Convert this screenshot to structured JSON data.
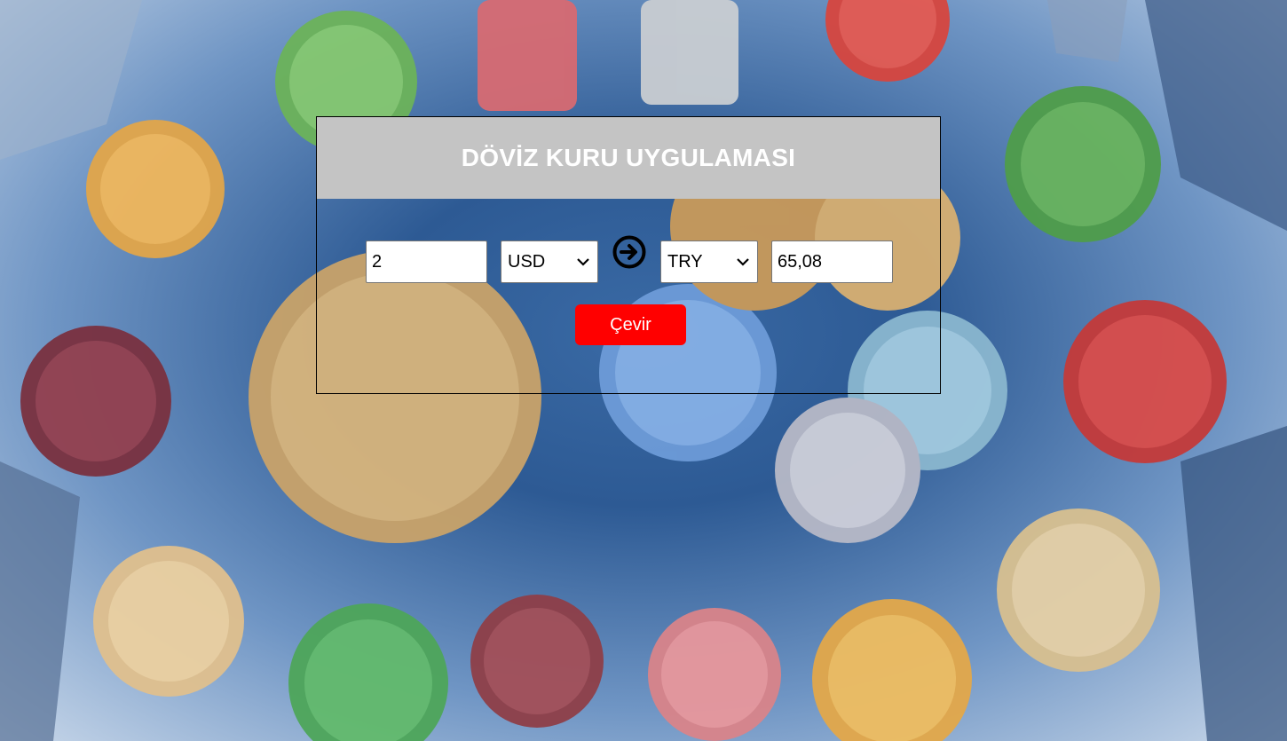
{
  "app": {
    "title": "DÖVİZ KURU UYGULAMASI"
  },
  "converter": {
    "amount_value": "2",
    "from_currency": "USD",
    "to_currency": "TRY",
    "result_value": "65,08",
    "arrow_icon": "arrow-right-circle-icon",
    "convert_label": "Çevir"
  },
  "colors": {
    "header_bg": "#c4c4c4",
    "title_text": "#ffffff",
    "button_bg": "#ff0000",
    "button_text": "#ffffff",
    "card_border": "#000000"
  },
  "background": {
    "description_icon": "coin-stacks-background-image"
  }
}
